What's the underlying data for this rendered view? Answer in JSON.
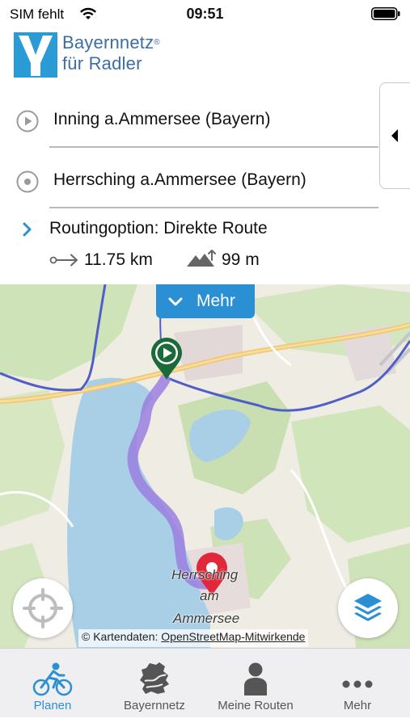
{
  "status_bar": {
    "carrier": "SIM fehlt",
    "time": "09:51"
  },
  "logo": {
    "line1": "Bayernnetz",
    "registered": "®",
    "line2": "für Radler",
    "brand_color": "#2b9bd6"
  },
  "route": {
    "start": "Inning a.Ammersee (Bayern)",
    "destination": "Herrsching a.Ammersee (Bayern)",
    "option_label": "Routingoption: Direkte Route",
    "distance": "11.75 km",
    "elevation": "99 m"
  },
  "map": {
    "more_button": "Mehr",
    "town_label_1": "Herrsching",
    "town_label_2": "am",
    "town_label_3": "Ammersee",
    "attribution_prefix": "© Kartendaten: ",
    "attribution_link": "OpenStreetMap-Mitwirkende",
    "start_marker_color": "#1b6b3a",
    "end_marker_color": "#e0283a",
    "route_color": "#9b7fe0"
  },
  "tabs": [
    {
      "label": "Planen",
      "icon": "bicycle-icon",
      "active": true
    },
    {
      "label": "Bayernnetz",
      "icon": "bavaria-map-icon",
      "active": false
    },
    {
      "label": "Meine Routen",
      "icon": "person-icon",
      "active": false
    },
    {
      "label": "Mehr",
      "icon": "more-dots-icon",
      "active": false
    }
  ],
  "colors": {
    "accent": "#2b8fd4"
  }
}
